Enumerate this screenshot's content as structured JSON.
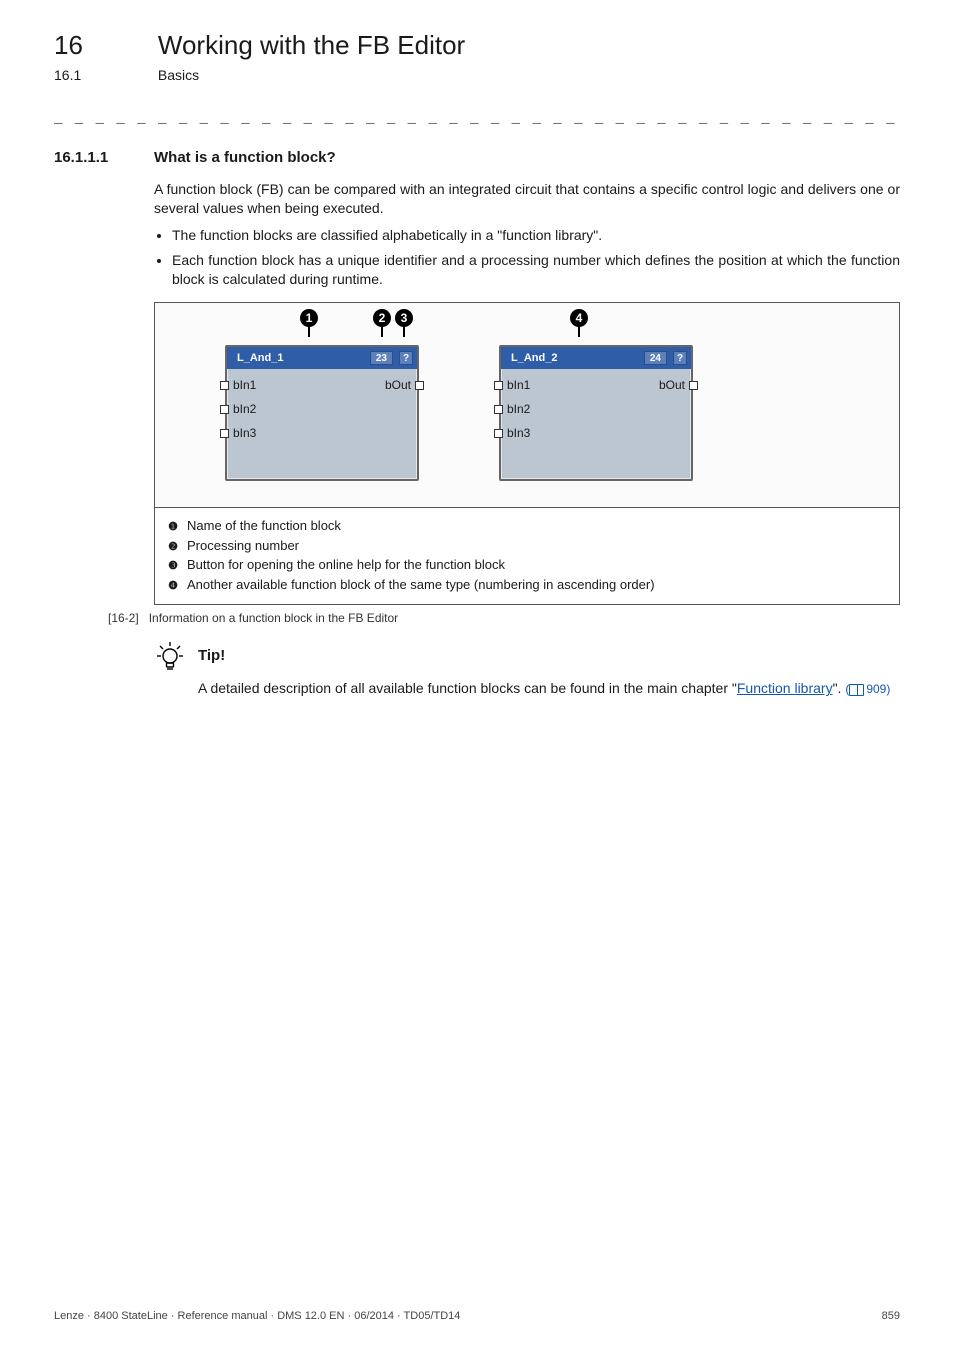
{
  "header": {
    "chapter_number": "16",
    "chapter_title": "Working with the FB Editor",
    "section_number": "16.1",
    "section_title": "Basics"
  },
  "sec": {
    "num": "16.1.1.1",
    "title": "What is a function block?"
  },
  "para1": "A function block (FB) can be compared with an integrated circuit that contains a specific control logic and delivers one or several values when being executed.",
  "bullets": [
    "The function blocks are classified alphabetically in a \"function library\".",
    "Each function block has a unique identifier and a processing number which defines the position at which the function block is calculated during runtime."
  ],
  "fb": {
    "blocks": [
      {
        "name": "L_And_1",
        "number": "23",
        "help": "?",
        "inputs": [
          "bIn1",
          "bIn2",
          "bIn3"
        ],
        "output": "bOut"
      },
      {
        "name": "L_And_2",
        "number": "24",
        "help": "?",
        "inputs": [
          "bIn1",
          "bIn2",
          "bIn3"
        ],
        "output": "bOut"
      }
    ],
    "callouts": {
      "c1": "1",
      "c2": "2",
      "c3": "3",
      "c4": "4"
    },
    "captions": [
      "Name of the function block",
      "Processing number",
      "Button for opening the online help for the function block",
      "Another available function block of the same type (numbering in ascending order)"
    ]
  },
  "fig_caption": {
    "num": "[16-2]",
    "text": "Information on a function block in the FB Editor"
  },
  "tip": {
    "label": "Tip!",
    "text_before": "A detailed description of all available function blocks can be found in the main chapter \"",
    "link": "Function library",
    "text_after": "\".",
    "paren_open": "(",
    "page": "909",
    "paren_close": ")"
  },
  "footer": {
    "left": "Lenze · 8400 StateLine · Reference manual · DMS 12.0 EN · 06/2014 · TD05/TD14",
    "right": "859"
  },
  "circled": {
    "c1": "❶",
    "c2": "❷",
    "c3": "❸",
    "c4": "❹"
  }
}
